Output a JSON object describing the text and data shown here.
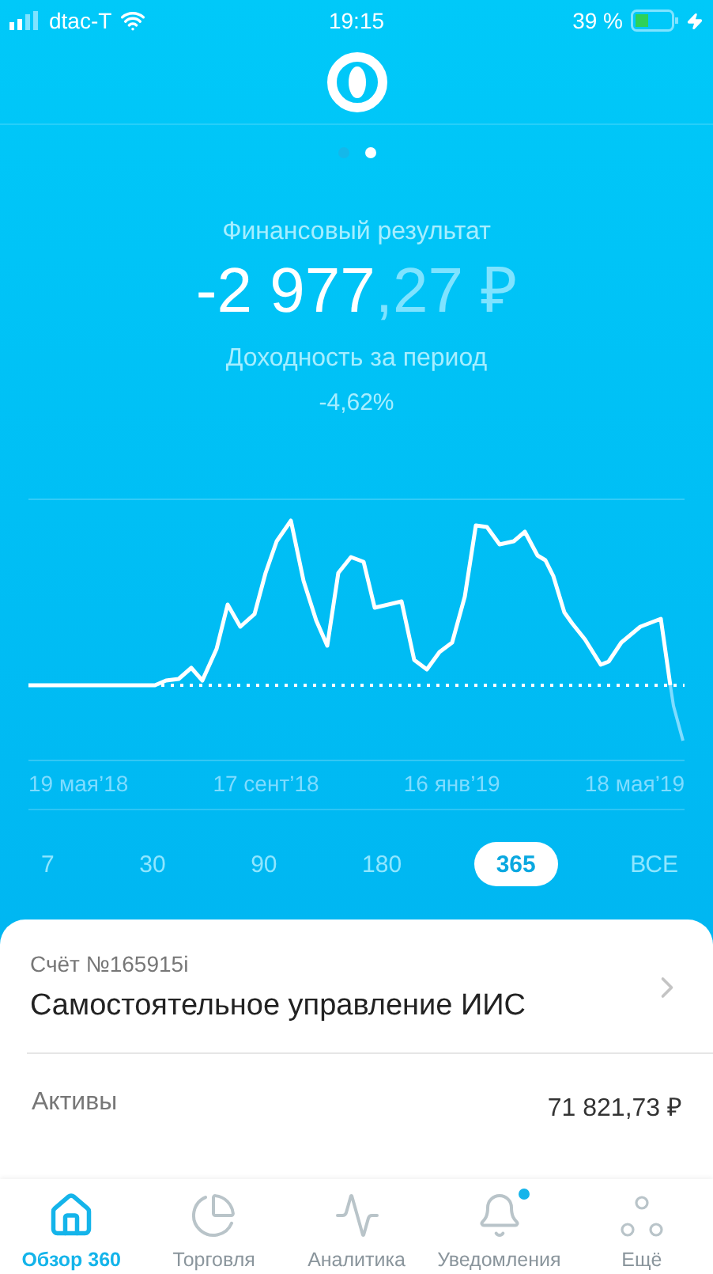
{
  "status_bar": {
    "carrier": "dtac-T",
    "time": "19:15",
    "battery": "39 %"
  },
  "pages": [
    {
      "selected": false
    },
    {
      "selected": true
    }
  ],
  "summary": {
    "title": "Финансовый результат",
    "amount_main": "-2 977",
    "amount_fraction": ",27 ₽",
    "yield_label": "Доходность за период",
    "yield_value": "-4,62%"
  },
  "chart": {
    "dates": [
      "19 мая’18",
      "17 сент’18",
      "16 янв’19",
      "18 мая’19"
    ]
  },
  "periods": [
    {
      "label": "7",
      "selected": false
    },
    {
      "label": "30",
      "selected": false
    },
    {
      "label": "90",
      "selected": false
    },
    {
      "label": "180",
      "selected": false
    },
    {
      "label": "365",
      "selected": true
    },
    {
      "label": "ВСЕ",
      "selected": false
    }
  ],
  "account": {
    "number": "Счёт №165915i",
    "name": "Самостоятельное управление ИИС",
    "assets_label": "Активы",
    "assets_value": "71 821,73 ₽"
  },
  "tab_bar": [
    {
      "kind": "home",
      "label": "Обзор 360",
      "selected": true,
      "badge": false
    },
    {
      "kind": "pie",
      "label": "Торговля",
      "selected": false,
      "badge": false
    },
    {
      "kind": "pulse",
      "label": "Аналитика",
      "selected": false,
      "badge": false
    },
    {
      "kind": "bell",
      "label": "Уведомления",
      "selected": false,
      "badge": true
    },
    {
      "kind": "dots",
      "label": "Ещё",
      "selected": false,
      "badge": false
    }
  ]
}
